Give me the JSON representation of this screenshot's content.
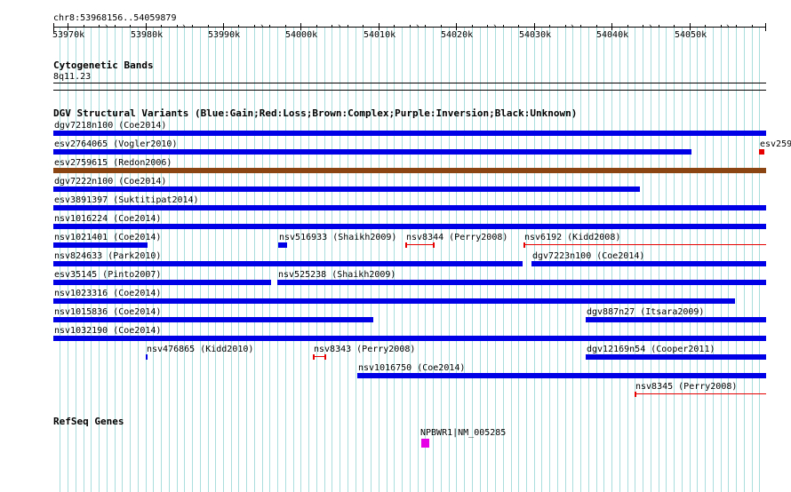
{
  "ruler": {
    "region": "chr8:53968156..54059879",
    "ticks": [
      {
        "pos": 53970000,
        "label": "53970k"
      },
      {
        "pos": 53980000,
        "label": "53980k"
      },
      {
        "pos": 53990000,
        "label": "53990k"
      },
      {
        "pos": 54000000,
        "label": "54000k"
      },
      {
        "pos": 54010000,
        "label": "54010k"
      },
      {
        "pos": 54020000,
        "label": "54020k"
      },
      {
        "pos": 54030000,
        "label": "54030k"
      },
      {
        "pos": 54040000,
        "label": "54040k"
      },
      {
        "pos": 54050000,
        "label": "54050k"
      }
    ]
  },
  "cytoband": {
    "title": "Cytogenetic Bands",
    "band": "8q11.23"
  },
  "dgv": {
    "title": "DGV Structural Variants (Blue:Gain;Red:Loss;Brown:Complex;Purple:Inversion;Black:Unknown)",
    "colors": {
      "gain": "#0000e6",
      "loss": "#e60000",
      "complex": "#8b4513"
    },
    "rows": [
      [
        {
          "label": "dgv7218n100 (Coe2014)",
          "start": 53968156,
          "end": 54059879,
          "type": "gain"
        }
      ],
      [
        {
          "label": "esv2764065 (Vogler2010)",
          "start": 53968156,
          "end": 54050300,
          "type": "gain"
        },
        {
          "label": "esv259",
          "start": 54058950,
          "end": 54059650,
          "type": "loss"
        }
      ],
      [
        {
          "label": "esv2759615 (Redon2006)",
          "start": 53968156,
          "end": 54059879,
          "type": "complex"
        }
      ],
      [
        {
          "label": "dgv7222n100 (Coe2014)",
          "start": 53968156,
          "end": 54043600,
          "type": "gain"
        }
      ],
      [
        {
          "label": "esv3891397 (Suktitipat2014)",
          "start": 53968156,
          "end": 54059879,
          "type": "gain"
        }
      ],
      [
        {
          "label": "nsv1016224 (Coe2014)",
          "start": 53968156,
          "end": 54059879,
          "type": "gain"
        }
      ],
      [
        {
          "label": "nsv1021401 (Coe2014)",
          "start": 53968156,
          "end": 53980300,
          "type": "gain"
        },
        {
          "label": "nsv516933 (Shaikh2009)",
          "start": 53997050,
          "end": 53998200,
          "type": "gain"
        },
        {
          "label": "nsv8344 (Perry2008)",
          "start": 54013500,
          "end": 54017200,
          "type": "loss",
          "style": "bracket"
        },
        {
          "label": "nsv6192 (Kidd2008)",
          "start": 54028700,
          "end": 54059879,
          "type": "loss",
          "style": "line"
        }
      ],
      [
        {
          "label": "nsv824633 (Park2010)",
          "start": 53968156,
          "end": 54028500,
          "type": "gain"
        },
        {
          "label": "dgv7223n100 (Coe2014)",
          "start": 54029700,
          "end": 54059879,
          "type": "gain"
        }
      ],
      [
        {
          "label": "esv35145 (Pinto2007)",
          "start": 53968156,
          "end": 53996200,
          "type": "gain"
        },
        {
          "label": "nsv525238 (Shaikh2009)",
          "start": 53997000,
          "end": 54059879,
          "type": "gain"
        }
      ],
      [
        {
          "label": "nsv1023316 (Coe2014)",
          "start": 53968156,
          "end": 54055900,
          "type": "gain"
        }
      ],
      [
        {
          "label": "nsv1015836 (Coe2014)",
          "start": 53968156,
          "end": 54009300,
          "type": "gain"
        },
        {
          "label": "dgv887n27 (Itsara2009)",
          "start": 54036700,
          "end": 54059879,
          "type": "gain"
        }
      ],
      [
        {
          "label": "nsv1032190 (Coe2014)",
          "start": 53968156,
          "end": 54059879,
          "type": "gain"
        }
      ],
      [
        {
          "label": "nsv476865 (Kidd2010)",
          "start": 53980100,
          "end": 53980300,
          "type": "gain"
        },
        {
          "label": "nsv8343 (Perry2008)",
          "start": 54001500,
          "end": 54003300,
          "type": "loss",
          "style": "bracket"
        },
        {
          "label": "dgv12169n54 (Cooper2011)",
          "start": 54036700,
          "end": 54059879,
          "type": "gain"
        }
      ],
      [
        {
          "label": "nsv1016750 (Coe2014)",
          "start": 54007300,
          "end": 54059879,
          "type": "gain"
        }
      ],
      [
        {
          "label": "nsv8345 (Perry2008)",
          "start": 54043000,
          "end": 54059879,
          "type": "loss",
          "style": "line"
        }
      ]
    ]
  },
  "refseq": {
    "title": "RefSeq Genes",
    "genes": [
      {
        "label": "NPBWR1|NM_005285",
        "start": 54015500,
        "end": 54016500,
        "color": "#e600e6"
      }
    ]
  }
}
